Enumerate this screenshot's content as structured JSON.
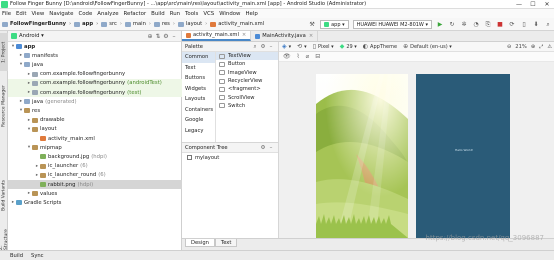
{
  "window": {
    "title": "Follow Finger Bunny [D:\\android\\FollowFingerBunny] - ...\\app\\src\\main\\res\\layout\\activity_main.xml [app] - Android Studio (Administrator)",
    "minimize": "—",
    "maximize": "☐",
    "close": "✕"
  },
  "menu": [
    "File",
    "Edit",
    "View",
    "Navigate",
    "Code",
    "Analyze",
    "Refactor",
    "Build",
    "Run",
    "Tools",
    "VCS",
    "Window",
    "Help"
  ],
  "breadcrumbs": [
    "FollowFingerBunny",
    "app",
    "src",
    "main",
    "res",
    "layout",
    "activity_main.xml"
  ],
  "toolbar": {
    "run_config": "app",
    "device": "HUAWEI HUAWEI M2-801W"
  },
  "left_tabs": {
    "project": "1: Project",
    "resource_manager": "Resource Manager",
    "build_variants": "Build Variants",
    "structure": "Z: Structure",
    "favorites": "2: Favorites"
  },
  "project_panel": {
    "view_selector": "Android",
    "tree": [
      {
        "label": "app",
        "level": 0,
        "icon": "app",
        "arrow": "▾",
        "bold": true
      },
      {
        "label": "manifests",
        "level": 1,
        "icon": "folder",
        "arrow": "▸"
      },
      {
        "label": "java",
        "level": 1,
        "icon": "folder",
        "arrow": "▾"
      },
      {
        "label": "com.example.followfingerbunny",
        "level": 2,
        "icon": "pkg",
        "arrow": "▸"
      },
      {
        "label": "com.example.followfingerbunny",
        "suffix": "(androidTest)",
        "level": 2,
        "icon": "pkg",
        "arrow": "▸",
        "green": true
      },
      {
        "label": "com.example.followfingerbunny",
        "suffix": "(test)",
        "level": 2,
        "icon": "pkg",
        "arrow": "▸",
        "green": true
      },
      {
        "label": "java",
        "suffix": "(generated)",
        "level": 1,
        "icon": "folder",
        "arrow": "▸"
      },
      {
        "label": "res",
        "level": 1,
        "icon": "res",
        "arrow": "▾"
      },
      {
        "label": "drawable",
        "level": 2,
        "icon": "res",
        "arrow": "▸"
      },
      {
        "label": "layout",
        "level": 2,
        "icon": "res",
        "arrow": "▾"
      },
      {
        "label": "activity_main.xml",
        "level": 3,
        "icon": "xml",
        "arrow": ""
      },
      {
        "label": "mipmap",
        "level": 2,
        "icon": "res",
        "arrow": "▾"
      },
      {
        "label": "background.jpg",
        "suffix": "(hdpi)",
        "level": 3,
        "icon": "img",
        "arrow": ""
      },
      {
        "label": "ic_launcher",
        "suffix": "(6)",
        "level": 3,
        "icon": "res",
        "arrow": "▸"
      },
      {
        "label": "ic_launcher_round",
        "suffix": "(6)",
        "level": 3,
        "icon": "res",
        "arrow": "▸"
      },
      {
        "label": "rabbit.png",
        "suffix": "(hdpi)",
        "level": 3,
        "icon": "img",
        "arrow": "",
        "selected": true
      },
      {
        "label": "values",
        "level": 2,
        "icon": "res",
        "arrow": "▸"
      },
      {
        "label": "Gradle Scripts",
        "level": 0,
        "icon": "gradle",
        "arrow": "▸"
      }
    ]
  },
  "editor_tabs": [
    {
      "label": "activity_main.xml",
      "active": true,
      "color": "#e07a3c"
    },
    {
      "label": "MainActivity.java",
      "active": false,
      "color": "#4c8bd6"
    }
  ],
  "palette": {
    "title": "Palette",
    "categories": [
      "Common",
      "Text",
      "Buttons",
      "Widgets",
      "Layouts",
      "Containers",
      "Google",
      "Legacy"
    ],
    "selected_category": 0,
    "widgets": [
      "TextView",
      "Button",
      "ImageView",
      "RecyclerView",
      "<fragment>",
      "ScrollView",
      "Switch"
    ],
    "selected_widget": 0
  },
  "component_tree": {
    "title": "Component Tree",
    "items": [
      "mylayout"
    ]
  },
  "design_toolbar": {
    "device": "Pixel",
    "api": "29",
    "theme": "AppTheme",
    "locale": "Default (en-us)",
    "zoom": "21%"
  },
  "blueprint": {
    "text": "Hello World!"
  },
  "design_tabs": [
    "Design",
    "Text"
  ],
  "bottom_tabs": [
    "Build",
    "Sync"
  ],
  "watermark": "https://blog.csdn.net/qq_3096887"
}
